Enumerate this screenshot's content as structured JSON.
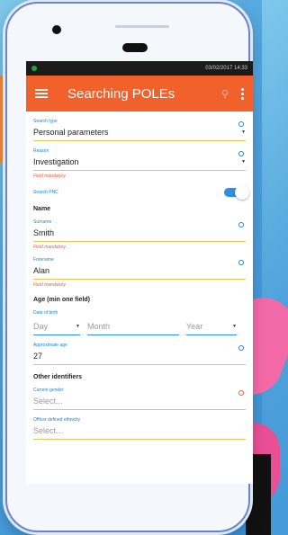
{
  "status": {
    "datetime": "03/02/2017 14:33"
  },
  "appbar": {
    "title": "Searching POLEs"
  },
  "form": {
    "search_type": {
      "label": "Search type",
      "value": "Personal parameters"
    },
    "reason": {
      "label": "Reason",
      "value": "Investigation",
      "mandatory": "Field mandatory"
    },
    "search_pnc": {
      "label": "Search PNC",
      "enabled": true
    },
    "name_section": "Name",
    "surname": {
      "label": "Surname",
      "value": "Smith",
      "mandatory": "Field mandatory"
    },
    "forename": {
      "label": "Forename",
      "value": "Alan",
      "mandatory": "Field mandatory"
    },
    "age_section": "Age (min one field)",
    "dob": {
      "label": "Date of birth",
      "day": "Day",
      "month": "Month",
      "year": "Year"
    },
    "approx_age": {
      "label": "Approximate age",
      "value": "27"
    },
    "other_section": "Other identifiers",
    "gender": {
      "label": "Current gender",
      "placeholder": "Select..."
    },
    "ethnicity": {
      "label": "Officer defined ethnicity",
      "placeholder": "Select..."
    }
  },
  "colors": {
    "accent": "#f1612c",
    "primary": "#1a84d6",
    "mandatory": "#f05b3c"
  }
}
